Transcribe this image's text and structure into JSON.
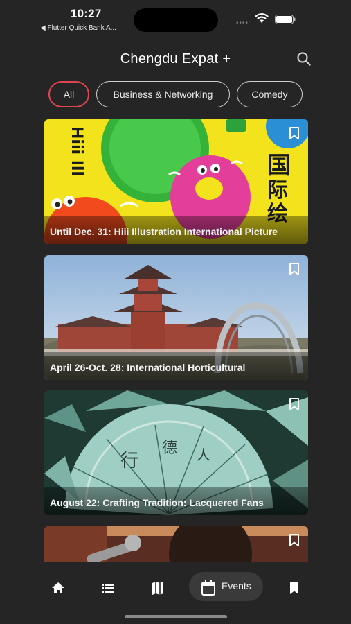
{
  "status_bar": {
    "time": "10:27",
    "back_app": "◀ Flutter Quick Bank A...",
    "dots": "••••"
  },
  "header": {
    "title": "Chengdu Expat +",
    "search_icon": "search-icon"
  },
  "filters": [
    {
      "label": "All",
      "active": true
    },
    {
      "label": "Business & Networking",
      "active": false
    },
    {
      "label": "Comedy",
      "active": false
    }
  ],
  "events": [
    {
      "title": "Until Dec. 31: Hiii Illustration International Picture",
      "image": "illustration-festival-poster",
      "bookmarked": false
    },
    {
      "title": "April 26-Oct. 28: International Horticultural",
      "image": "pagoda-and-arch-bridge",
      "bookmarked": false
    },
    {
      "title": "August 22: Crafting Tradition: Lacquered Fans",
      "image": "lacquered-fans",
      "bookmarked": false
    },
    {
      "title": "",
      "image": "singer-with-microphone",
      "bookmarked": false
    }
  ],
  "nav": {
    "items": [
      "home-icon",
      "list-icon",
      "map-icon",
      "events-icon",
      "bookmark-icon"
    ],
    "events_label": "Events",
    "active": "events"
  },
  "colors": {
    "background": "#252525",
    "active_chip_border": "#e0454f",
    "chip_border": "#cfcfcf",
    "nav_pill": "#3a3a3a"
  }
}
